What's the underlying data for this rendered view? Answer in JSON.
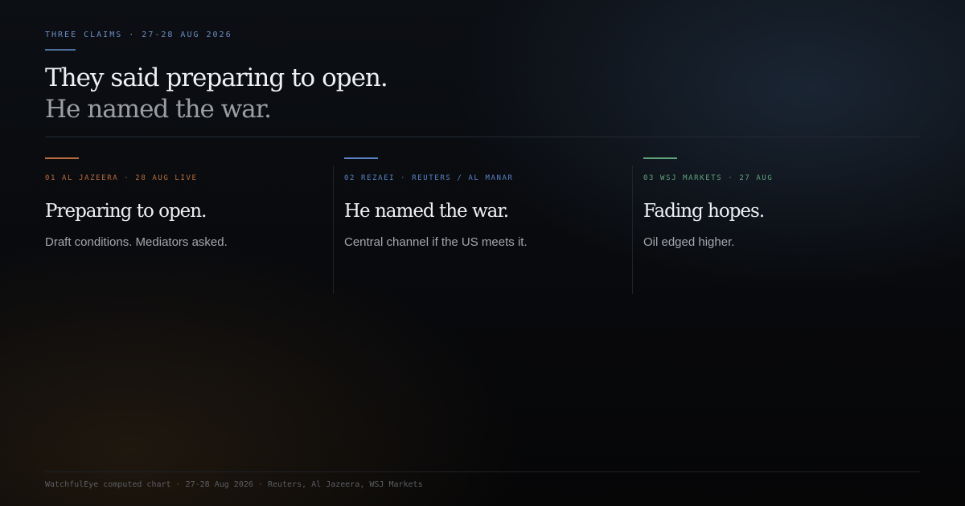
{
  "kicker": "THREE CLAIMS · 27-28 AUG 2026",
  "headline": {
    "line1": "They said preparing to open.",
    "line2": "He named the war."
  },
  "claims": [
    {
      "meta": "01 AL JAZEERA · 28 AUG LIVE",
      "title": "Preparing to open.",
      "body": "Draft conditions. Mediators asked.",
      "accent_color": "#b86b3c"
    },
    {
      "meta": "02 REZAEI · REUTERS / AL MANAR",
      "title": "He named the war.",
      "body": "Central channel if the US meets it.",
      "accent_color": "#5a82c4"
    },
    {
      "meta": "03 WSJ MARKETS · 27 AUG",
      "title": "Fading hopes.",
      "body": "Oil edged higher.",
      "accent_color": "#5ea37a"
    }
  ],
  "footer": "WatchfulEye computed chart · 27-28 Aug 2026 · Reuters, Al Jazeera, WSJ Markets",
  "colors": {
    "kicker": "#6a8fc4",
    "headline_primary": "#eef0f3",
    "headline_secondary": "#9c9ea2"
  }
}
